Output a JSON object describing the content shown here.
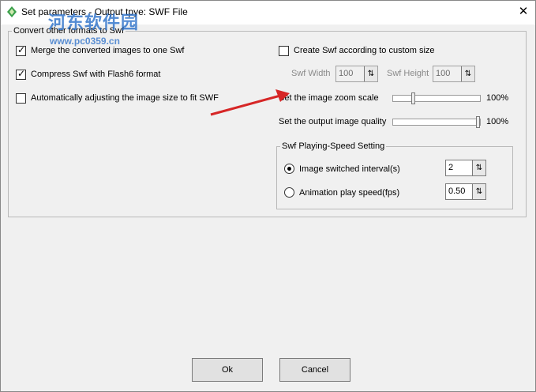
{
  "window": {
    "title": "Set parameters - Output tpye: SWF File",
    "close_glyph": "✕"
  },
  "watermark": {
    "text": "河东软件园",
    "url": "www.pc0359.cn"
  },
  "convert_group": {
    "legend": "Convert other formats to Swf",
    "merge_label": "Merge the converted images to one Swf",
    "merge_checked": true,
    "compress_label": "Compress Swf with Flash6 format",
    "compress_checked": true,
    "auto_adjust_label": "Automatically adjusting the image size to fit SWF",
    "auto_adjust_checked": false,
    "custom_size_label": "Create Swf according to custom size",
    "custom_size_checked": false,
    "width_label": "Swf Width",
    "width_value": "100",
    "height_label": "Swf Height",
    "height_value": "100",
    "zoom_label": "Set the image zoom scale",
    "zoom_value_text": "100%",
    "zoom_fraction": 0.23,
    "quality_label": "Set the output image quality",
    "quality_value_text": "100%",
    "quality_fraction": 1.0
  },
  "speed_group": {
    "legend": "Swf Playing-Speed Setting",
    "interval_label": "Image switched interval(s)",
    "interval_value": "2",
    "fps_label": "Animation play speed(fps)",
    "fps_value": "0.50",
    "selected": "interval"
  },
  "buttons": {
    "ok": "Ok",
    "cancel": "Cancel"
  },
  "colors": {
    "arrow": "#d62626",
    "watermark": "#2b6fc7"
  }
}
